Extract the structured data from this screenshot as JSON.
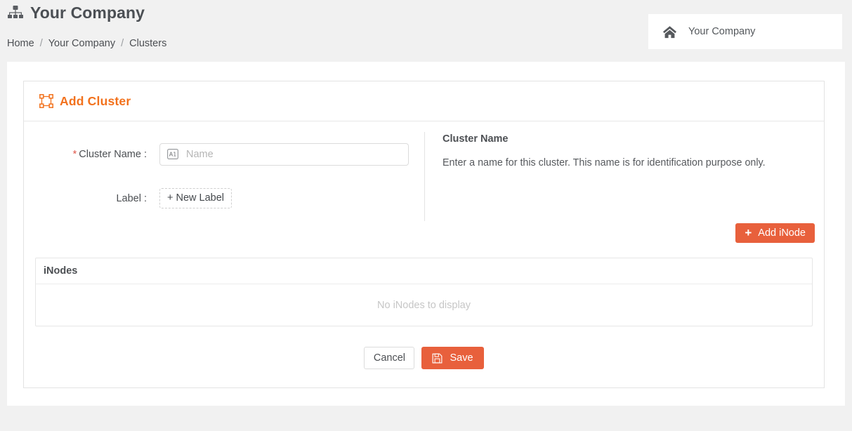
{
  "header": {
    "brand_title": "Your Company",
    "brand_icon": "sitemap-icon",
    "breadcrumb": {
      "home": "Home",
      "company": "Your Company",
      "current": "Clusters",
      "separator": "/"
    },
    "company_card": {
      "icon": "home-icon",
      "label": "Your Company"
    }
  },
  "panel": {
    "icon": "object-group-icon",
    "title": "Add Cluster",
    "accent_color": "#f2711c"
  },
  "form": {
    "cluster_name": {
      "required_marker": "*",
      "label": "Cluster Name :",
      "placeholder": "Name",
      "value": "",
      "icon": "input-text-icon"
    },
    "label_field": {
      "label": "Label :",
      "new_label_button": "+ New Label"
    }
  },
  "help": {
    "title": "Cluster Name",
    "text": "Enter a name for this cluster. This name is for identification purpose only."
  },
  "inodes": {
    "add_button": {
      "icon": "plus-icon",
      "label": "Add iNode",
      "color": "#e8603c"
    },
    "table": {
      "column_header": "iNodes",
      "empty_message": "No iNodes to display",
      "rows": []
    }
  },
  "actions": {
    "cancel": "Cancel",
    "save": "Save",
    "save_icon": "floppy-save-icon",
    "save_color": "#e8603c"
  }
}
